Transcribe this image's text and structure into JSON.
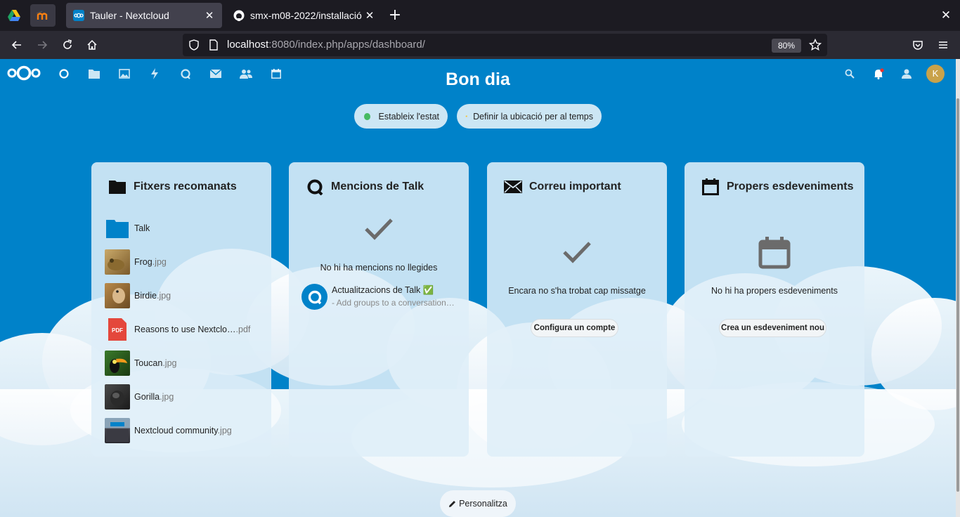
{
  "browser": {
    "tabs": [
      {
        "title": "Tauler - Nextcloud",
        "active": true
      },
      {
        "title": "smx-m08-2022/installació",
        "active": false
      }
    ],
    "url": {
      "host": "localhost",
      "rest": ":8080/index.php/apps/dashboard/"
    },
    "zoom": "80%"
  },
  "header": {
    "apps": [
      "dashboard-icon",
      "files-icon",
      "photos-icon",
      "activity-icon",
      "talk-icon",
      "mail-icon",
      "contacts-icon",
      "calendar-icon"
    ],
    "avatar_initial": "K"
  },
  "greeting": "Bon dia",
  "status_button": "Estableix l'estat",
  "weather_button": "Definir la ubicació per al temps",
  "panels": {
    "files": {
      "title": "Fitxers recomanats",
      "items": [
        {
          "name": "Talk",
          "ext": "",
          "kind": "folder"
        },
        {
          "name": "Frog",
          "ext": ".jpg",
          "kind": "image"
        },
        {
          "name": "Birdie",
          "ext": ".jpg",
          "kind": "image"
        },
        {
          "name": "Reasons to use Nextclo…",
          "ext": ".pdf",
          "kind": "pdf"
        },
        {
          "name": "Toucan",
          "ext": ".jpg",
          "kind": "image"
        },
        {
          "name": "Gorilla",
          "ext": ".jpg",
          "kind": "image"
        },
        {
          "name": "Nextcloud community",
          "ext": ".jpg",
          "kind": "image"
        }
      ]
    },
    "talk": {
      "title": "Mencions de Talk",
      "empty": "No hi ha mencions no llegides",
      "conversation_title": "Actualitzacions de Talk ✅",
      "conversation_sub": "- Add groups to a conversation…"
    },
    "mail": {
      "title": "Correu important",
      "empty": "Encara no s'ha trobat cap missatge",
      "button": "Configura un compte"
    },
    "calendar": {
      "title": "Propers esdeveniments",
      "empty": "No hi ha propers esdeveniments",
      "button": "Crea un esdeveniment nou"
    }
  },
  "customize_button": "Personalitza",
  "pdf_badge": "PDF",
  "colors": {
    "brand": "#0082c9",
    "status_online": "#46ba61",
    "pdf": "#e4473c"
  }
}
